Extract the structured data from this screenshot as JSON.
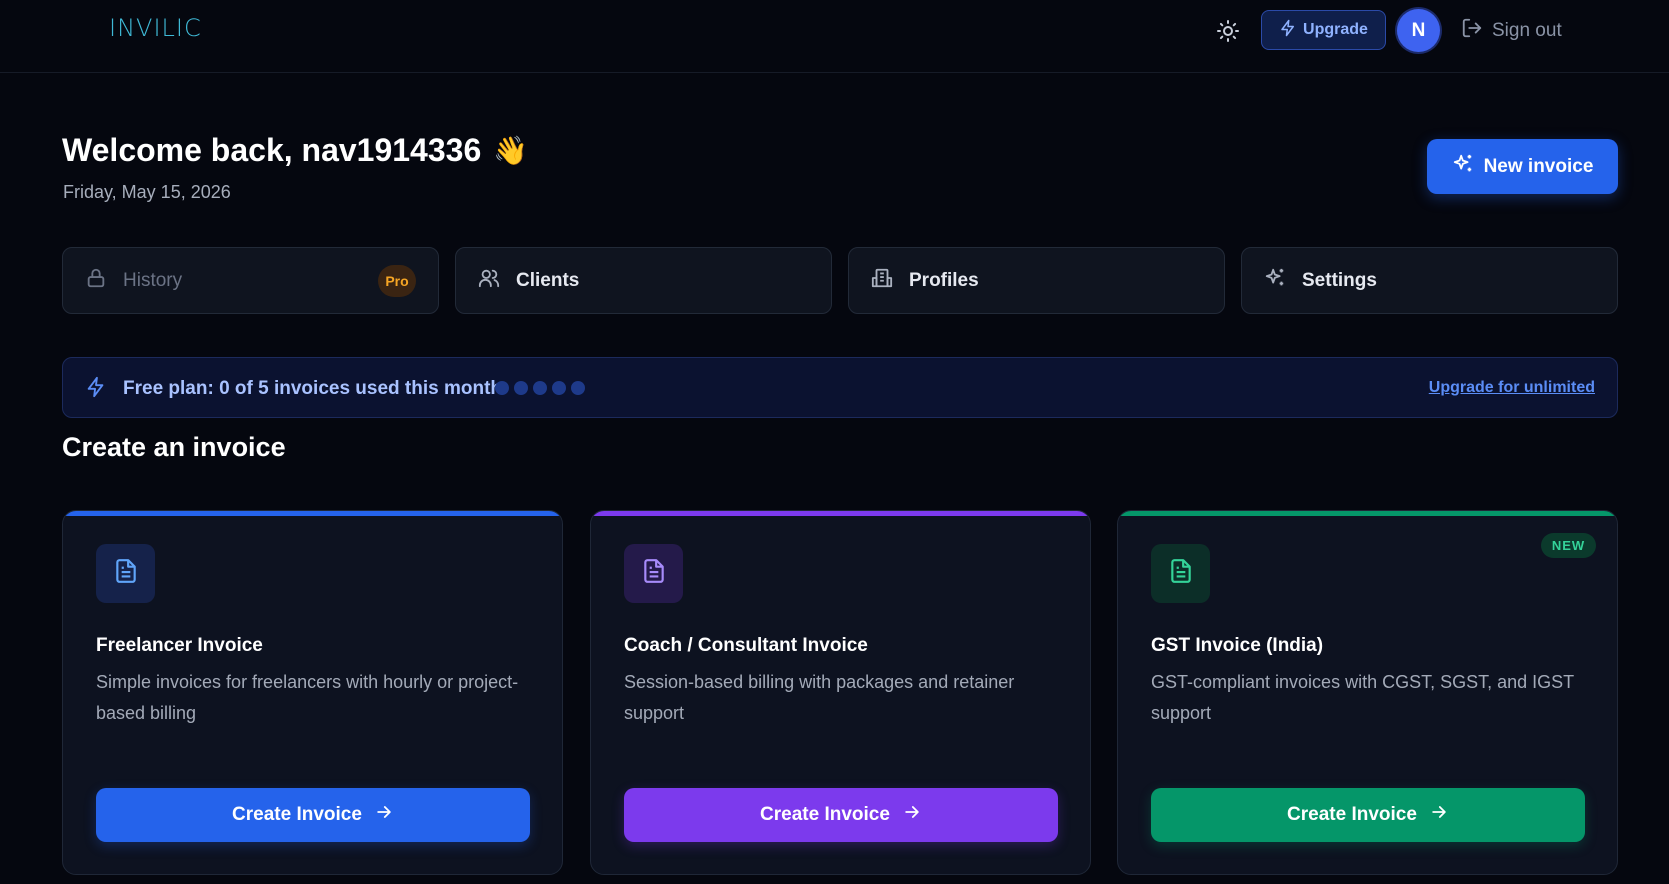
{
  "header": {
    "logo": "INVILIC",
    "upgrade_label": "Upgrade",
    "avatar_initial": "N",
    "signout_label": "Sign out"
  },
  "welcome": {
    "title": "Welcome back, nav1914336",
    "emoji": "👋",
    "date": "Friday, May 15, 2026",
    "new_invoice_label": "New invoice"
  },
  "nav": {
    "history": {
      "label": "History",
      "badge": "Pro",
      "icon": "lock-icon",
      "locked": true
    },
    "clients": {
      "label": "Clients",
      "icon": "users-icon"
    },
    "profiles": {
      "label": "Profiles",
      "icon": "building-icon"
    },
    "settings": {
      "label": "Settings",
      "icon": "sparkles-icon"
    }
  },
  "plan": {
    "text": "Free plan: 0 of 5 invoices used this month",
    "used": 0,
    "limit": 5,
    "link": "Upgrade for unlimited"
  },
  "section_title": "Create an invoice",
  "cards": [
    {
      "title": "Freelancer Invoice",
      "description": "Simple invoices for freelancers with hourly or project-based billing",
      "cta": "Create Invoice",
      "accent": "#2563eb",
      "icon_bg": "#15224a",
      "icon_color": "#60a5fa",
      "icon": "document-icon"
    },
    {
      "title": "Coach / Consultant Invoice",
      "description": "Session-based billing with packages and retainer support",
      "cta": "Create Invoice",
      "accent": "#7c3aed",
      "icon_bg": "#241a4a",
      "icon_color": "#a78bfa",
      "icon": "document-icon"
    },
    {
      "title": "GST Invoice (India)",
      "description": "GST-compliant invoices with CGST, SGST, and IGST support",
      "cta": "Create Invoice",
      "accent": "#059669",
      "icon_bg": "#0c2e28",
      "icon_color": "#34d399",
      "icon": "document-icon",
      "badge": "NEW"
    }
  ]
}
